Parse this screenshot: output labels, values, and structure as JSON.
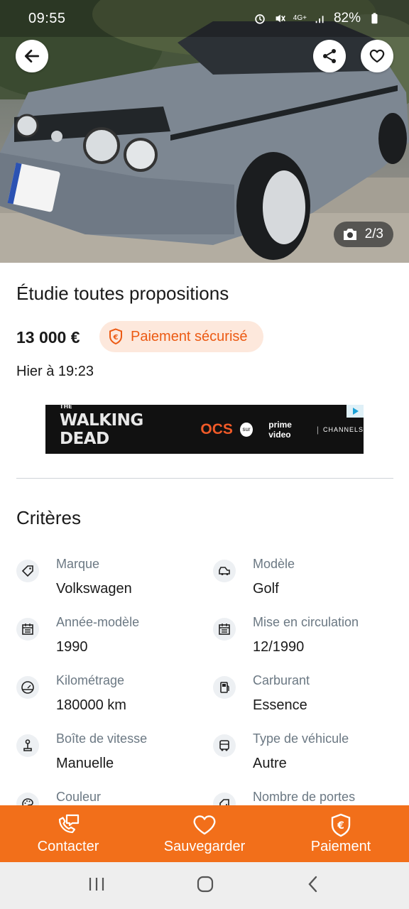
{
  "status_bar": {
    "time": "09:55",
    "network": "4G+",
    "battery": "82%"
  },
  "gallery": {
    "counter": "2/3"
  },
  "listing": {
    "title": "Étudie toutes propositions",
    "price": "13 000 €",
    "secure_badge": "Paiement sécurisé",
    "date": "Hier à 19:23"
  },
  "ad": {
    "brand_pre": "THE",
    "show": "WALKING DEAD",
    "channel": "OCS",
    "sur": "sur",
    "platform": "prime video",
    "channels": "CHANNELS"
  },
  "criteria": {
    "title": "Critères",
    "items": [
      {
        "label": "Marque",
        "value": "Volkswagen",
        "icon": "tag-icon"
      },
      {
        "label": "Modèle",
        "value": "Golf",
        "icon": "car-icon"
      },
      {
        "label": "Année-modèle",
        "value": "1990",
        "icon": "calendar-icon"
      },
      {
        "label": "Mise en circulation",
        "value": "12/1990",
        "icon": "calendar-icon"
      },
      {
        "label": "Kilométrage",
        "value": "180000 km",
        "icon": "gauge-icon"
      },
      {
        "label": "Carburant",
        "value": "Essence",
        "icon": "fuel-icon"
      },
      {
        "label": "Boîte de vitesse",
        "value": "Manuelle",
        "icon": "gearshift-icon"
      },
      {
        "label": "Type de véhicule",
        "value": "Autre",
        "icon": "vehicle-icon"
      },
      {
        "label": "Couleur",
        "value": "",
        "icon": "palette-icon"
      },
      {
        "label": "Nombre de portes",
        "value": "",
        "icon": "door-icon"
      }
    ]
  },
  "actions": {
    "contact": "Contacter",
    "save": "Sauvegarder",
    "pay": "Paiement"
  },
  "colors": {
    "accent": "#f26f1a",
    "badge_bg": "#fde8dc",
    "badge_text": "#ec5a13"
  }
}
